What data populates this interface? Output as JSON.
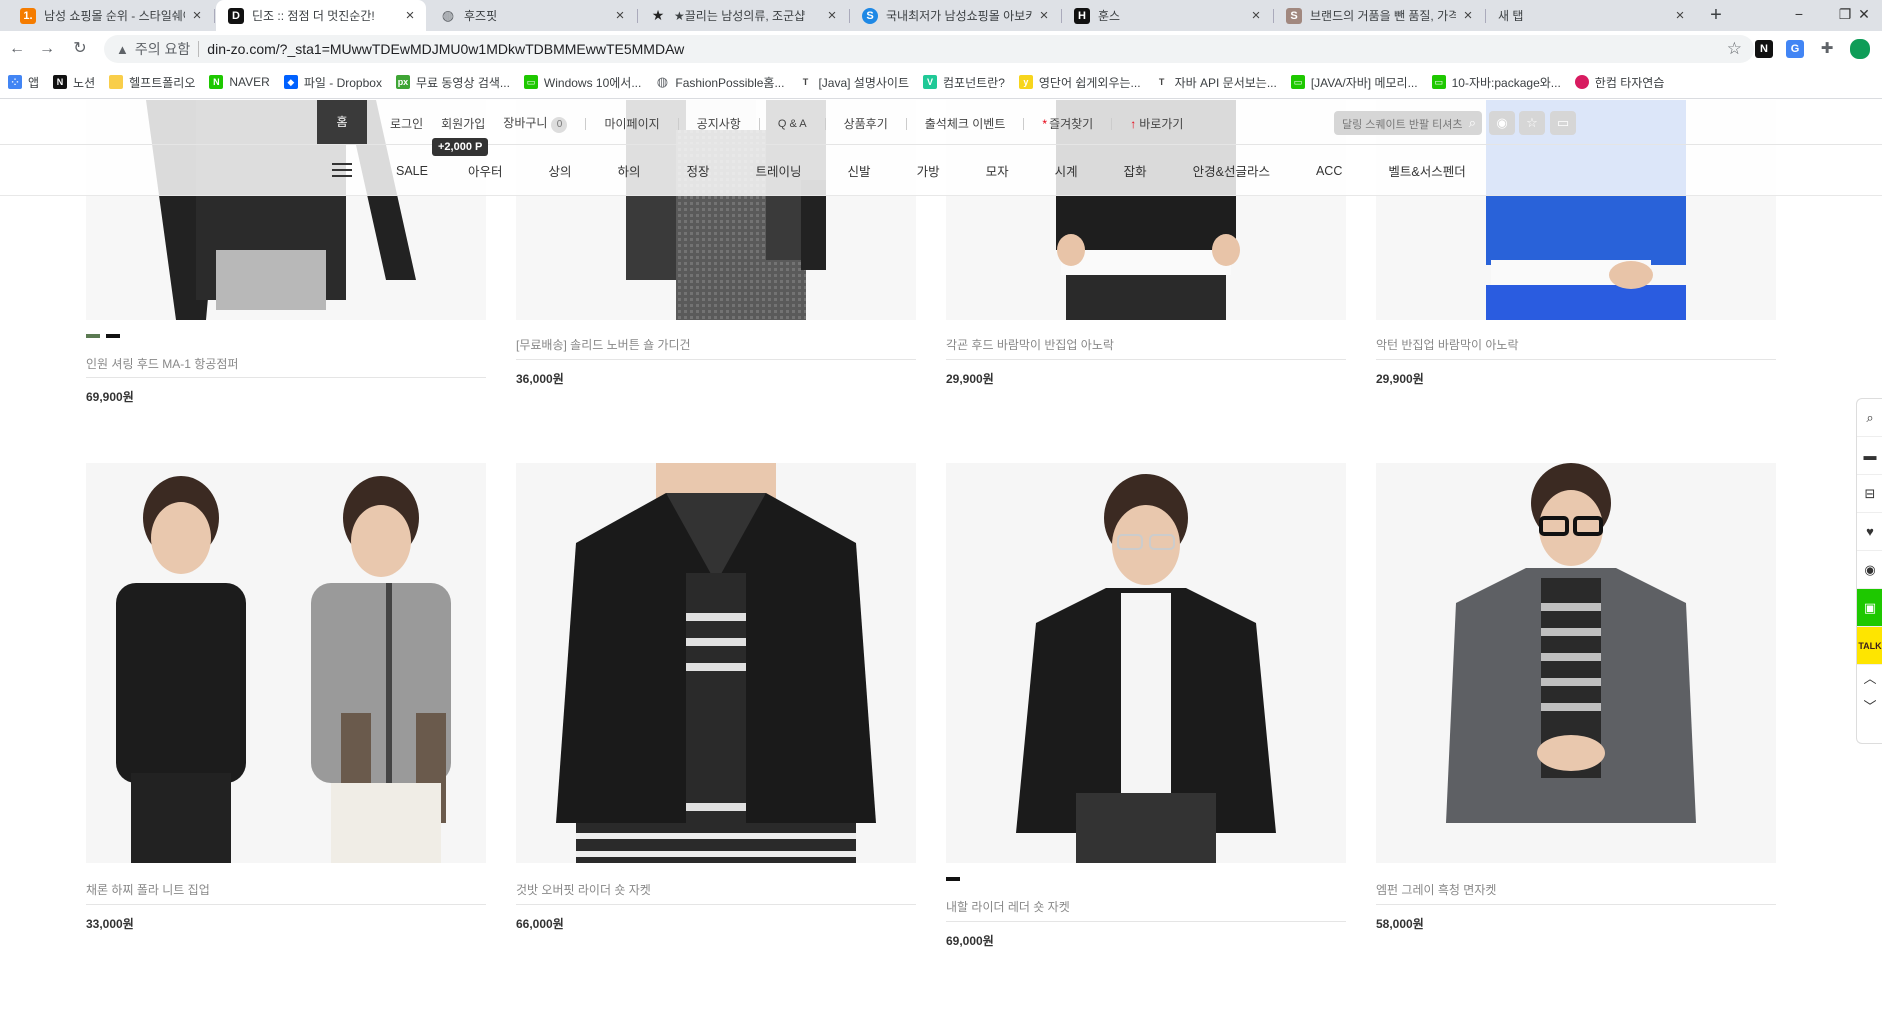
{
  "browser": {
    "tabs": [
      {
        "title": "남성 쇼핑몰 순위 - 스타일쉐어",
        "favicon": "1.",
        "favicon_color": "#f57c00"
      },
      {
        "title": "딘조 :: 점점 더 멋진순간!",
        "favicon": "D",
        "favicon_color": "#111111",
        "active": true
      },
      {
        "title": "후즈핏",
        "favicon": "globe",
        "favicon_color": "#5f6368"
      },
      {
        "title": "★끌리는 남성의류, 조군샵",
        "favicon": "★",
        "favicon_color": "#222222"
      },
      {
        "title": "국내최저가 남성쇼핑몰 아보키",
        "favicon": "S",
        "favicon_color": "#1e88e5"
      },
      {
        "title": "훈스",
        "favicon": "H",
        "favicon_color": "#111111"
      },
      {
        "title": "브랜드의 거품을 뺀 품질, 가격",
        "favicon": "S",
        "favicon_color": "#a1887f"
      },
      {
        "title": "새 탭",
        "favicon": "",
        "favicon_color": "#dee1e6"
      }
    ],
    "new_tab_icon": "+",
    "window_controls": [
      "−",
      "❐",
      "✕"
    ],
    "security_warning": "주의 요함",
    "url": "din-zo.com/?_sta1=MUwwTDEwMDJMU0w1MDkwTDBMMEwwTE5MMDAw",
    "bookmarks": [
      {
        "label": "앱",
        "icon": "apps",
        "color": "#4285f4"
      },
      {
        "label": "노션",
        "icon": "N",
        "color": "#111111"
      },
      {
        "label": "헬프트폴리오",
        "icon": "folder",
        "color": "#f9ce4a"
      },
      {
        "label": "NAVER",
        "icon": "N",
        "color": "#1ec800"
      },
      {
        "label": "파일 - Dropbox",
        "icon": "dropbox",
        "color": "#0061ff"
      },
      {
        "label": "무료 동영상 검색...",
        "icon": "px",
        "color": "#3fa535"
      },
      {
        "label": "Windows 10에서...",
        "icon": "chat",
        "color": "#1ec800"
      },
      {
        "label": "FashionPossible홈...",
        "icon": "globe",
        "color": "#5f6368"
      },
      {
        "label": "[Java] 설명사이트",
        "icon": "T",
        "color": "#444444"
      },
      {
        "label": "컴포넌트란?",
        "icon": "V",
        "color": "#20c997"
      },
      {
        "label": "영단어 쉽게외우는...",
        "icon": "y",
        "color": "#f7d51d"
      },
      {
        "label": "자바 API 문서보는...",
        "icon": "T",
        "color": "#444444"
      },
      {
        "label": "[JAVA/자바] 메모리...",
        "icon": "chat",
        "color": "#1ec800"
      },
      {
        "label": "10-자바:package와...",
        "icon": "chat",
        "color": "#1ec800"
      },
      {
        "label": "한컴 타자연습",
        "icon": "hancom",
        "color": "#d81b60"
      }
    ]
  },
  "site": {
    "home_label": "홈",
    "top_links": {
      "login": "로그인",
      "join": "회원가입",
      "cart": "장바구니",
      "cart_count": "0",
      "mypage": "마이페이지",
      "notice": "공지사항",
      "qna": "Q & A",
      "review": "상품후기",
      "attendance": "출석체크 이벤트",
      "favorite": "즐겨찾기",
      "shortcut": "바로가기"
    },
    "join_point_badge": "+2,000 P",
    "search_placeholder": "달링 스퀘이트 반팔 티셔츠",
    "menu": [
      "SALE",
      "아우터",
      "상의",
      "하의",
      "정장",
      "트레이닝",
      "신발",
      "가방",
      "모자",
      "시계",
      "잡화",
      "안경&선글라스",
      "ACC",
      "벨트&서스펜더"
    ]
  },
  "products_row1": [
    {
      "name": "인원 셔링 후드 MA-1 항공점퍼",
      "price": "69,900원",
      "swatches": [
        "#5b7a52",
        "#111111"
      ]
    },
    {
      "name": "[무료배송] 솔리드 노버튼 숄 가디건",
      "price": "36,000원",
      "swatches": []
    },
    {
      "name": "각굔 후드 바람막이 반집업 아노락",
      "price": "29,900원",
      "swatches": []
    },
    {
      "name": "악턴 반집업 바람막이 아노락",
      "price": "29,900원",
      "swatches": []
    }
  ],
  "products_row2": [
    {
      "name": "채론 하찌 폴라 니트 집업",
      "price": "33,000원",
      "swatches": []
    },
    {
      "name": "것밧 오버핏 라이더 숏 자켓",
      "price": "66,000원",
      "swatches": []
    },
    {
      "name": "내할 라이더 레더 숏 자켓",
      "price": "69,000원",
      "swatches": [
        "#111111"
      ]
    },
    {
      "name": "엠펀 그레이 흑청 면자켓",
      "price": "58,000원",
      "swatches": []
    }
  ],
  "quickbar_icons": [
    "search-icon",
    "truck-icon",
    "cart-icon",
    "heart-icon",
    "eye-icon",
    "naver-talk-icon",
    "kakao-talk-icon",
    "arrow-up-icon",
    "arrow-down-icon"
  ],
  "quickbar_kakao_label": "TALK"
}
